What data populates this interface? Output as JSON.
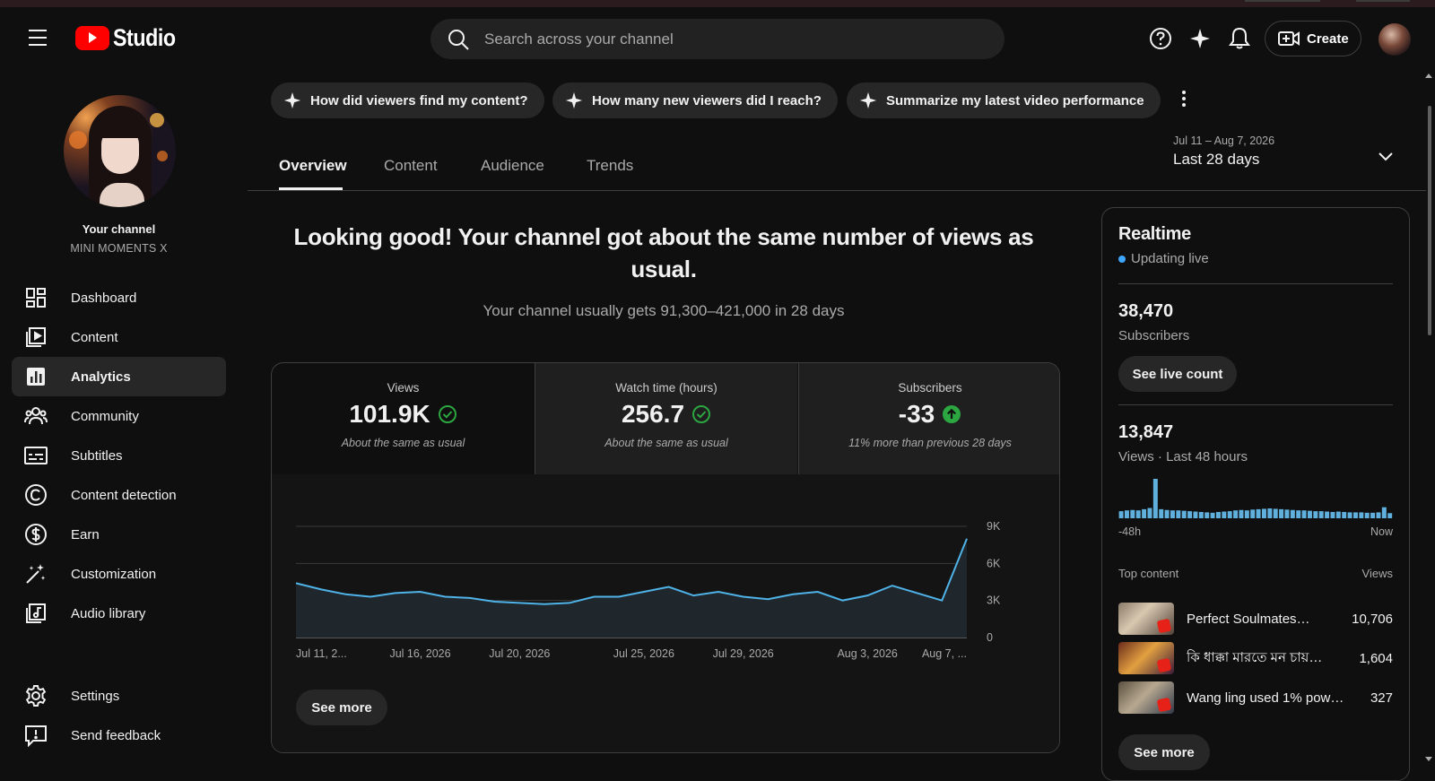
{
  "header": {
    "brand": "Studio",
    "search_placeholder": "Search across your channel",
    "create_label": "Create",
    "icons": [
      "menu-icon",
      "help-icon",
      "sparkle-icon",
      "bell-icon",
      "create-video-icon"
    ]
  },
  "channel": {
    "label": "Your channel",
    "name": "MINI MOMENTS X"
  },
  "sidebar": {
    "items": [
      {
        "label": "Dashboard",
        "icon": "dashboard-icon"
      },
      {
        "label": "Content",
        "icon": "content-icon"
      },
      {
        "label": "Analytics",
        "icon": "analytics-icon",
        "active": true
      },
      {
        "label": "Community",
        "icon": "community-icon"
      },
      {
        "label": "Subtitles",
        "icon": "subtitles-icon"
      },
      {
        "label": "Content detection",
        "icon": "copyright-icon"
      },
      {
        "label": "Earn",
        "icon": "dollar-icon"
      },
      {
        "label": "Customization",
        "icon": "magic-wand-icon"
      },
      {
        "label": "Audio library",
        "icon": "audio-library-icon"
      }
    ],
    "bottom": [
      {
        "label": "Settings",
        "icon": "gear-icon"
      },
      {
        "label": "Send feedback",
        "icon": "feedback-icon"
      }
    ]
  },
  "chips": [
    "How did viewers find my content?",
    "How many new viewers did I reach?",
    "Summarize my latest video performance"
  ],
  "tabs": [
    "Overview",
    "Content",
    "Audience",
    "Trends"
  ],
  "date_range": {
    "dates": "Jul 11 – Aug 7, 2026",
    "label": "Last 28 days"
  },
  "headline": "Looking good! Your channel got about the same number of views as usual.",
  "subline": "Your channel usually gets 91,300–421,000 in 28 days",
  "metrics": [
    {
      "label": "Views",
      "value": "101.9K",
      "status": "About the same as usual",
      "badge": "check"
    },
    {
      "label": "Watch time (hours)",
      "value": "256.7",
      "status": "About the same as usual",
      "badge": "check"
    },
    {
      "label": "Subscribers",
      "value": "-33",
      "status": "11% more than previous 28 days",
      "badge": "up-arrow"
    }
  ],
  "see_more": "See more",
  "colors": {
    "accent_line": "#4fb3e8",
    "check": "#2ba640",
    "brand_red": "#ff0000",
    "live_dot": "#3ea6ff"
  },
  "chart_data": {
    "type": "area",
    "x": [
      "Jul 11",
      "Jul 12",
      "Jul 13",
      "Jul 14",
      "Jul 15",
      "Jul 16",
      "Jul 17",
      "Jul 18",
      "Jul 19",
      "Jul 20",
      "Jul 21",
      "Jul 22",
      "Jul 23",
      "Jul 24",
      "Jul 25",
      "Jul 26",
      "Jul 27",
      "Jul 28",
      "Jul 29",
      "Jul 30",
      "Jul 31",
      "Aug 1",
      "Aug 2",
      "Aug 3",
      "Aug 4",
      "Aug 5",
      "Aug 6",
      "Aug 7"
    ],
    "series": [
      {
        "values": [
          4400,
          3900,
          3500,
          3300,
          3600,
          3700,
          3300,
          3200,
          2900,
          2800,
          2700,
          2800,
          3300,
          3300,
          3700,
          4100,
          3400,
          3700,
          3300,
          3100,
          3500,
          3700,
          3000,
          3400,
          4200,
          3600,
          3000,
          8000
        ]
      }
    ],
    "x_tick_labels": [
      "Jul 11, 2...",
      "Jul 16, 2026",
      "Jul 20, 2026",
      "Jul 25, 2026",
      "Jul 29, 2026",
      "Aug 3, 2026",
      "Aug 7, ..."
    ],
    "y_tick_labels": [
      "0",
      "3K",
      "6K",
      "9K"
    ],
    "ylim": [
      0,
      9000
    ],
    "grid": true
  },
  "realtime": {
    "title": "Realtime",
    "status": "Updating live",
    "subscribers_value": "38,470",
    "subscribers_label": "Subscribers",
    "see_live_count": "See live count",
    "views_value": "13,847",
    "views_label": "Views · Last 48 hours",
    "axis_start": "-48h",
    "axis_end": "Now",
    "hourly_views": [
      180,
      200,
      210,
      200,
      230,
      260,
      1000,
      230,
      210,
      200,
      200,
      190,
      180,
      170,
      160,
      150,
      140,
      160,
      170,
      180,
      200,
      210,
      200,
      220,
      230,
      240,
      250,
      240,
      230,
      220,
      210,
      200,
      200,
      190,
      180,
      180,
      170,
      160,
      170,
      160,
      150,
      150,
      150,
      140,
      140,
      150,
      280,
      130
    ],
    "top_content_header": "Top content",
    "top_content_views_header": "Views",
    "top_content": [
      {
        "title": "Perfect Soulmates…",
        "views": "10,706"
      },
      {
        "title": "কি ধাক্কা মারতে মন চায়…",
        "views": "1,604"
      },
      {
        "title": "Wang ling used 1% pow…",
        "views": "327"
      }
    ],
    "see_more": "See more"
  }
}
